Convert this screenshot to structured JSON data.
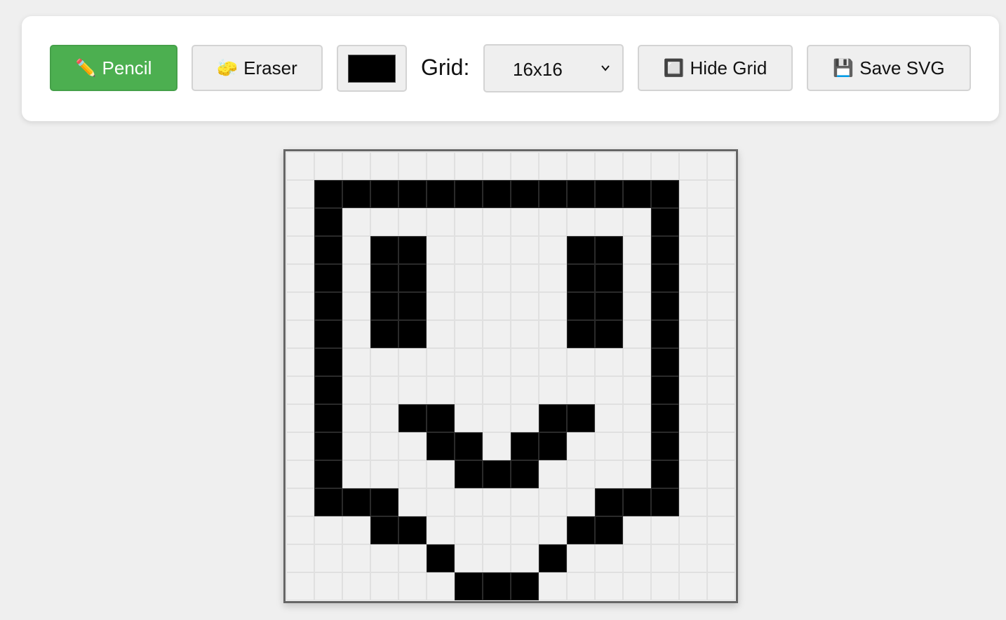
{
  "toolbar": {
    "pencil": {
      "icon": "✏️",
      "label": "Pencil",
      "active": true
    },
    "eraser": {
      "icon": "🧽",
      "label": "Eraser"
    },
    "color": {
      "value": "#000000"
    },
    "grid_label": "Grid:",
    "grid_select": {
      "value": "16x16"
    },
    "hide_grid": {
      "icon": "🔲",
      "label": "Hide Grid"
    },
    "save_svg": {
      "icon": "💾",
      "label": "Save SVG"
    }
  },
  "colors": {
    "accent": "#4caf50",
    "background": "#efefef",
    "empty_pixel": "#f0f0f0",
    "filled_pixel": "#000000"
  },
  "canvas": {
    "cols": 16,
    "rows": 16,
    "pixels": [
      "0000000000000000",
      "0111111111111100",
      "0100000000000100",
      "0101100000110100",
      "0101100000110100",
      "0101100000110100",
      "0101100000110100",
      "0100000000000100",
      "0100000000000100",
      "0100110001100100",
      "0100011011000100",
      "0100001110000100",
      "0111000000011100",
      "0001100000110000",
      "0000010001000000",
      "0000001110000000"
    ]
  }
}
